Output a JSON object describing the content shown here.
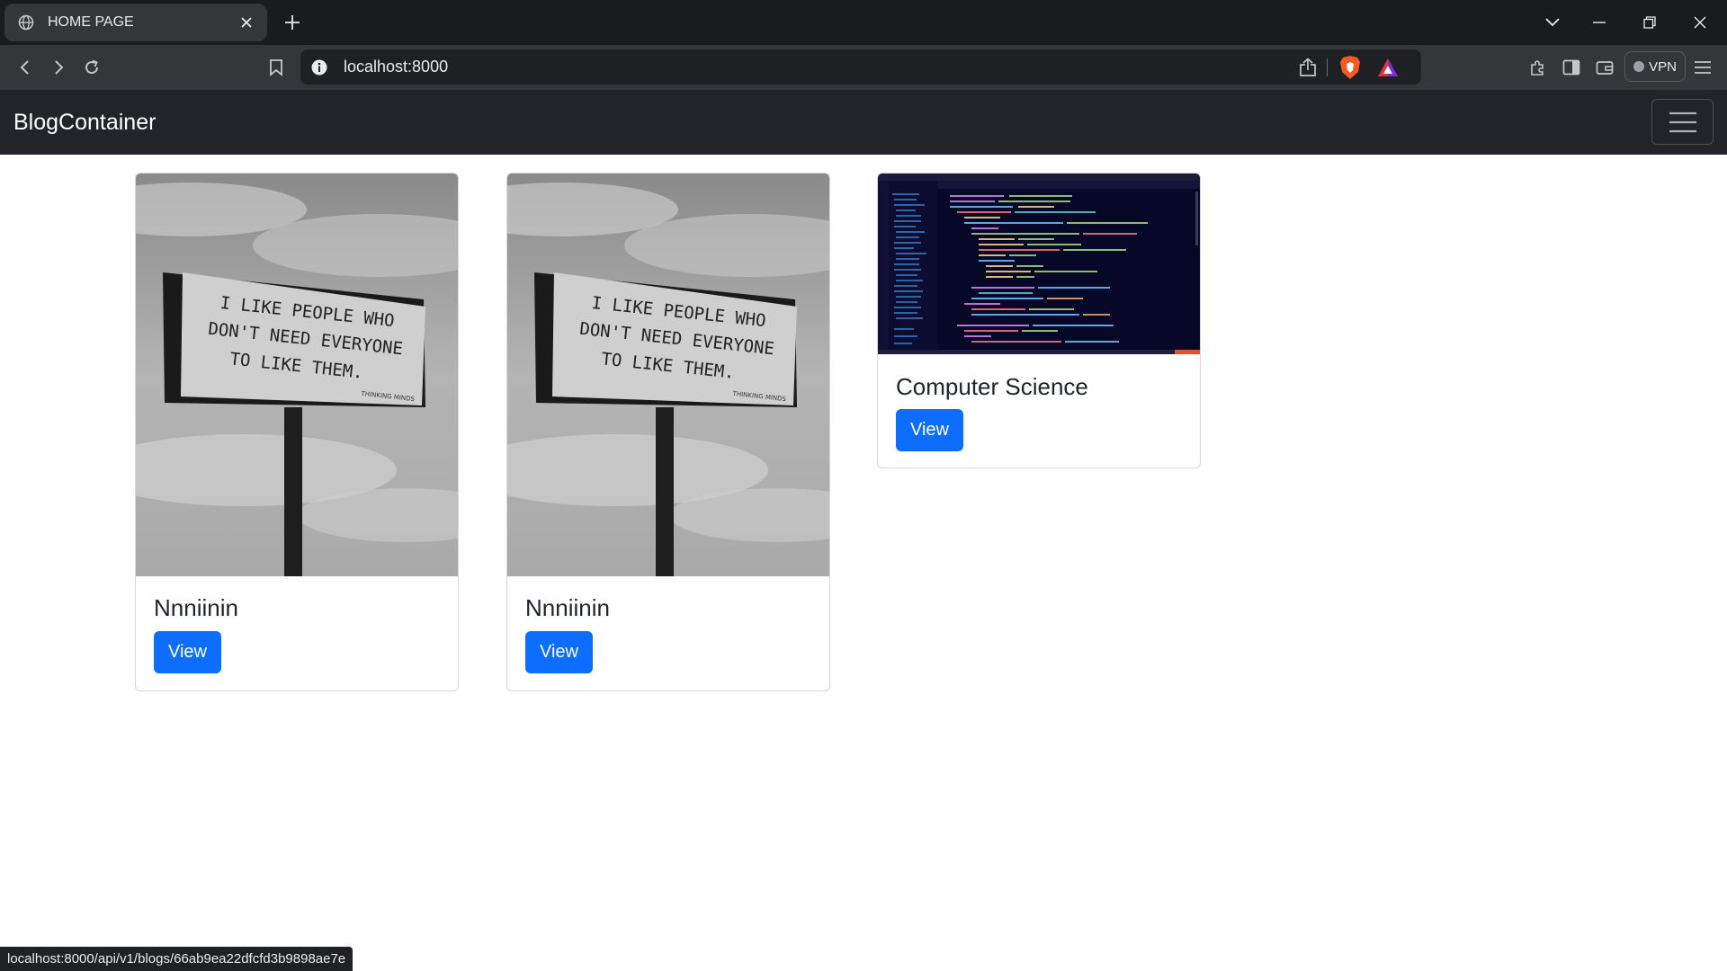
{
  "browser": {
    "tab_title": "HOME PAGE",
    "address": "localhost:8000",
    "vpn_label": "VPN",
    "icons": [
      "globe-icon",
      "close-icon",
      "plus-icon",
      "chevron-down-icon",
      "minimize-icon",
      "restore-icon",
      "window-close-icon",
      "back-icon",
      "forward-icon",
      "reload-icon",
      "bookmark-icon",
      "info-icon",
      "share-icon",
      "brave-shield-icon",
      "brave-rewards-icon",
      "extensions-icon",
      "sidebar-icon",
      "wallet-icon",
      "menu-icon"
    ]
  },
  "navbar": {
    "brand": "BlogContainer"
  },
  "cards": [
    {
      "title": "Nnniinin",
      "button": "View",
      "image": "billboard-photo"
    },
    {
      "title": "Nnniinin",
      "button": "View",
      "image": "billboard-photo"
    },
    {
      "title": "Computer Science",
      "button": "View",
      "image": "code-editor-screenshot"
    }
  ],
  "billboard_text": [
    "I LIKE PEOPLE WHO",
    "DON'T NEED EVERYONE",
    "TO LIKE THEM.",
    "THINKING MINDS"
  ],
  "status_url": "localhost:8000/api/v1/blogs/66ab9ea22dfcfd3b9898ae7e",
  "colors": {
    "navbar": "#212529",
    "primary_button": "#0d6efd",
    "browser_frame": "#1a1b1e",
    "toolbar": "#35363a"
  }
}
